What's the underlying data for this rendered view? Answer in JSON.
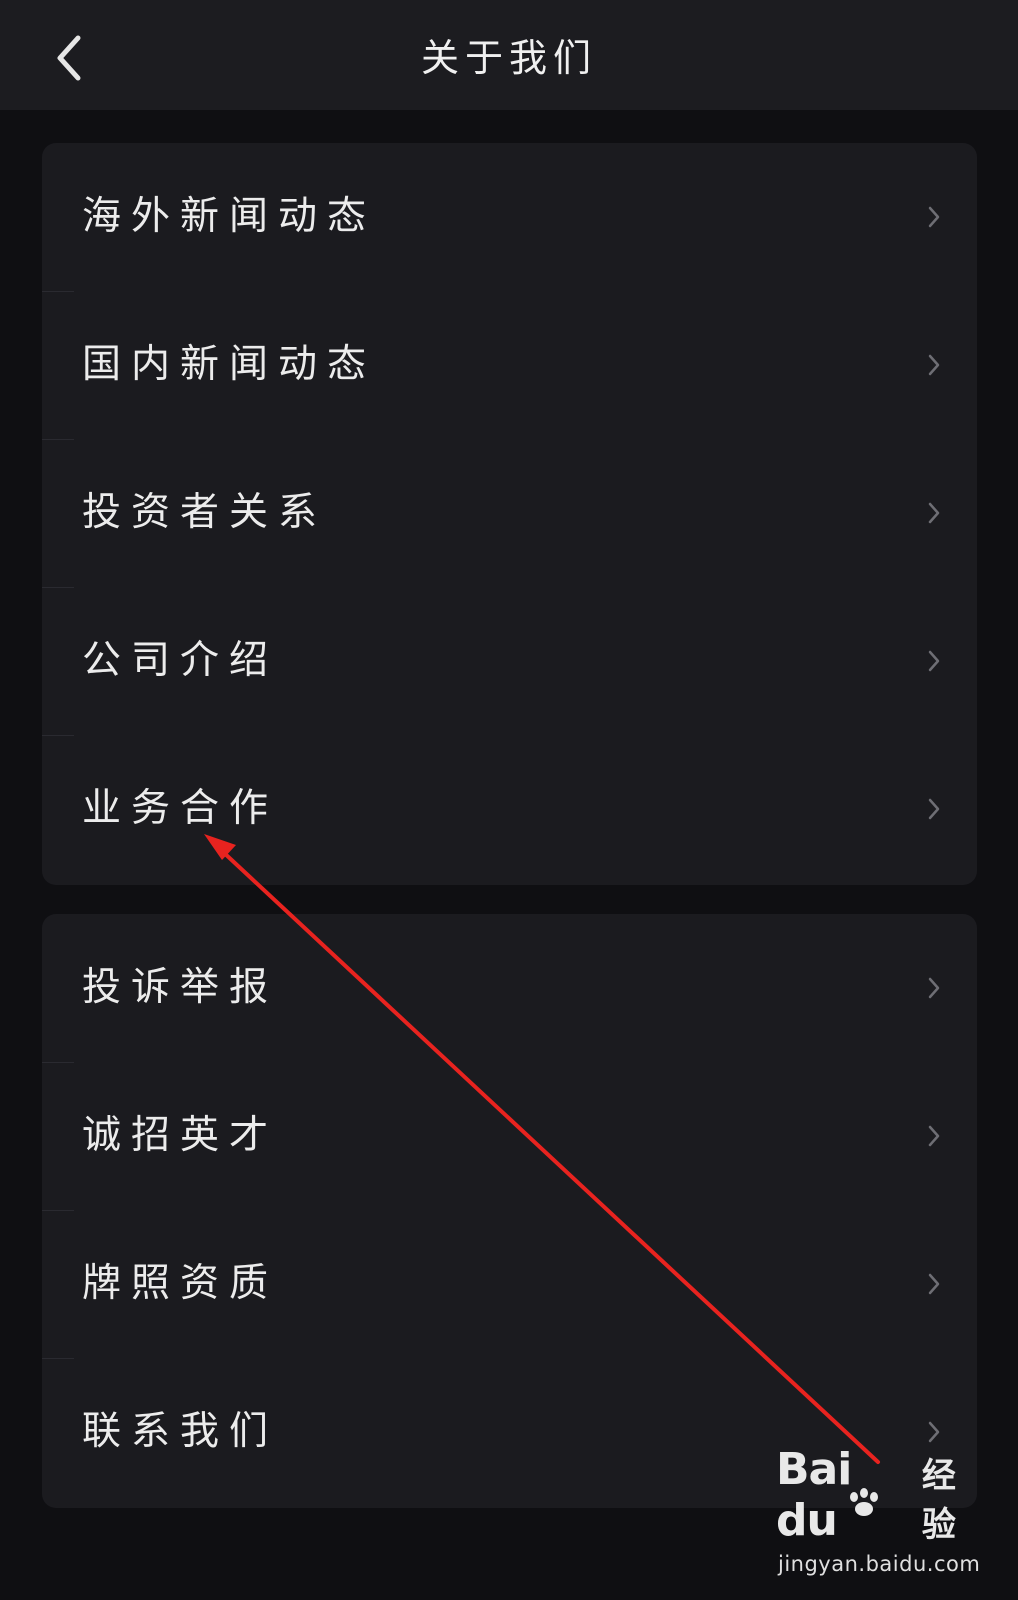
{
  "header": {
    "title": "关于我们",
    "back_icon": "chevron-left-icon"
  },
  "groups": [
    {
      "items": [
        {
          "label": "海外新闻动态"
        },
        {
          "label": "国内新闻动态"
        },
        {
          "label": "投资者关系"
        },
        {
          "label": "公司介绍"
        },
        {
          "label": "业务合作"
        }
      ]
    },
    {
      "items": [
        {
          "label": "投诉举报"
        },
        {
          "label": "诚招英才"
        },
        {
          "label": "牌照资质"
        },
        {
          "label": "联系我们"
        }
      ]
    }
  ],
  "annotation": {
    "type": "arrow",
    "color": "#e8231f",
    "points_to": "业务合作"
  },
  "watermark": {
    "brand_latin": "Bai du",
    "brand_cn": "经验",
    "url": "jingyan.baidu.com"
  },
  "colors": {
    "background": "#0f0f12",
    "nav_bar": "#1c1c20",
    "card": "#1b1b1f",
    "text": "#ececec",
    "chevron": "#6e6e74",
    "arrow": "#e8231f"
  }
}
